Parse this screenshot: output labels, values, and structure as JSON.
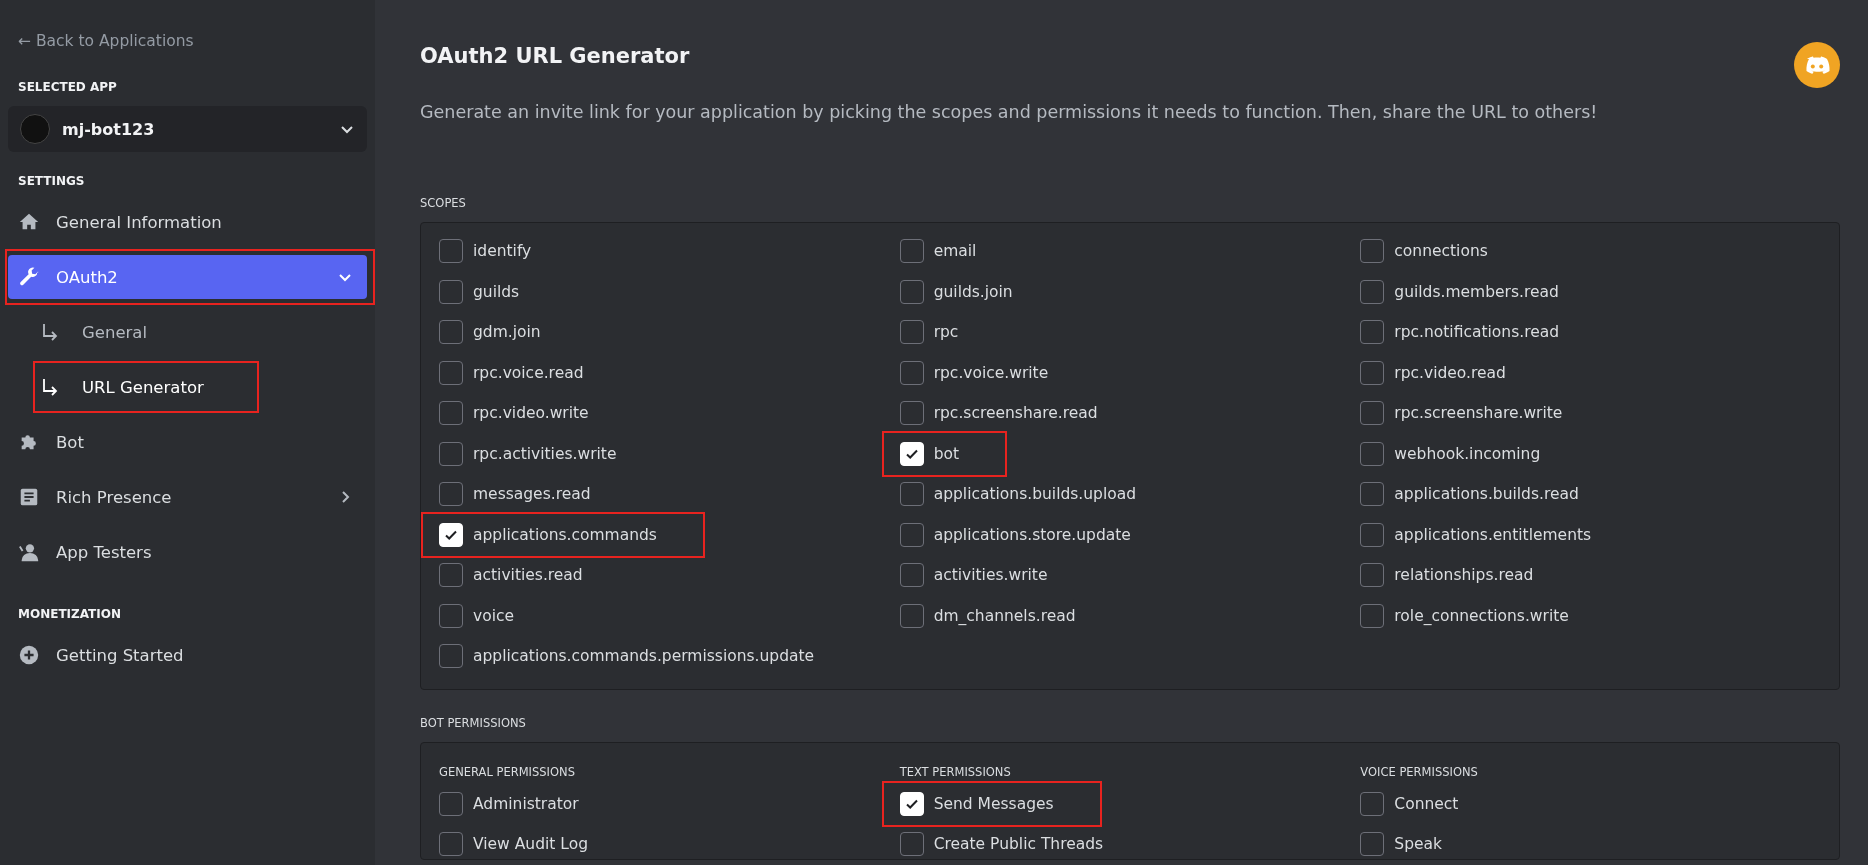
{
  "sidebar": {
    "back_link": "← Back to Applications",
    "selected_app_heading": "SELECTED APP",
    "app_select": {
      "name": "mj-bot123"
    },
    "sections": [
      {
        "heading": "SETTINGS",
        "items": [
          {
            "kind": "home",
            "label": "General Information",
            "selected": false,
            "highlighted": false
          },
          {
            "kind": "wrench",
            "label": "OAuth2",
            "selected": true,
            "highlighted": true,
            "expanded": true,
            "children": [
              {
                "label": "General",
                "selected": false,
                "highlighted": false
              },
              {
                "label": "URL Generator",
                "selected": true,
                "highlighted": true
              }
            ]
          },
          {
            "kind": "puzzle",
            "label": "Bot",
            "selected": false,
            "highlighted": false
          },
          {
            "kind": "document",
            "label": "Rich Presence",
            "selected": false,
            "highlighted": false,
            "expanded": false
          },
          {
            "kind": "person",
            "label": "App Testers",
            "selected": false,
            "highlighted": false
          }
        ]
      },
      {
        "heading": "MONETIZATION",
        "items": [
          {
            "kind": "plus",
            "label": "Getting Started",
            "selected": false,
            "highlighted": false
          }
        ]
      }
    ]
  },
  "page": {
    "title": "OAuth2 URL Generator",
    "description": "Generate an invite link for your application by picking the scopes and permissions it needs to function. Then, share the URL to others!"
  },
  "scopes": {
    "heading": "SCOPES",
    "items": [
      {
        "label": "identify",
        "checked": false,
        "highlighted": false
      },
      {
        "label": "email",
        "checked": false,
        "highlighted": false
      },
      {
        "label": "connections",
        "checked": false,
        "highlighted": false
      },
      {
        "label": "guilds",
        "checked": false,
        "highlighted": false
      },
      {
        "label": "guilds.join",
        "checked": false,
        "highlighted": false
      },
      {
        "label": "guilds.members.read",
        "checked": false,
        "highlighted": false
      },
      {
        "label": "gdm.join",
        "checked": false,
        "highlighted": false
      },
      {
        "label": "rpc",
        "checked": false,
        "highlighted": false
      },
      {
        "label": "rpc.notifications.read",
        "checked": false,
        "highlighted": false
      },
      {
        "label": "rpc.voice.read",
        "checked": false,
        "highlighted": false
      },
      {
        "label": "rpc.voice.write",
        "checked": false,
        "highlighted": false
      },
      {
        "label": "rpc.video.read",
        "checked": false,
        "highlighted": false
      },
      {
        "label": "rpc.video.write",
        "checked": false,
        "highlighted": false
      },
      {
        "label": "rpc.screenshare.read",
        "checked": false,
        "highlighted": false
      },
      {
        "label": "rpc.screenshare.write",
        "checked": false,
        "highlighted": false
      },
      {
        "label": "rpc.activities.write",
        "checked": false,
        "highlighted": false
      },
      {
        "label": "bot",
        "checked": true,
        "highlighted": true
      },
      {
        "label": "webhook.incoming",
        "checked": false,
        "highlighted": false
      },
      {
        "label": "messages.read",
        "checked": false,
        "highlighted": false
      },
      {
        "label": "applications.builds.upload",
        "checked": false,
        "highlighted": false
      },
      {
        "label": "applications.builds.read",
        "checked": false,
        "highlighted": false
      },
      {
        "label": "applications.commands",
        "checked": true,
        "highlighted": true
      },
      {
        "label": "applications.store.update",
        "checked": false,
        "highlighted": false
      },
      {
        "label": "applications.entitlements",
        "checked": false,
        "highlighted": false
      },
      {
        "label": "activities.read",
        "checked": false,
        "highlighted": false
      },
      {
        "label": "activities.write",
        "checked": false,
        "highlighted": false
      },
      {
        "label": "relationships.read",
        "checked": false,
        "highlighted": false
      },
      {
        "label": "voice",
        "checked": false,
        "highlighted": false
      },
      {
        "label": "dm_channels.read",
        "checked": false,
        "highlighted": false
      },
      {
        "label": "role_connections.write",
        "checked": false,
        "highlighted": false
      },
      {
        "label": "applications.commands.permissions.update",
        "checked": false,
        "highlighted": false
      }
    ]
  },
  "bot_permissions": {
    "heading": "BOT PERMISSIONS",
    "groups": [
      {
        "title": "GENERAL PERMISSIONS",
        "items": [
          {
            "label": "Administrator",
            "checked": false,
            "highlighted": false
          },
          {
            "label": "View Audit Log",
            "checked": false,
            "highlighted": false
          }
        ]
      },
      {
        "title": "TEXT PERMISSIONS",
        "items": [
          {
            "label": "Send Messages",
            "checked": true,
            "highlighted": true
          },
          {
            "label": "Create Public Threads",
            "checked": false,
            "highlighted": false
          }
        ]
      },
      {
        "title": "VOICE PERMISSIONS",
        "items": [
          {
            "label": "Connect",
            "checked": false,
            "highlighted": false
          },
          {
            "label": "Speak",
            "checked": false,
            "highlighted": false
          }
        ]
      }
    ]
  }
}
